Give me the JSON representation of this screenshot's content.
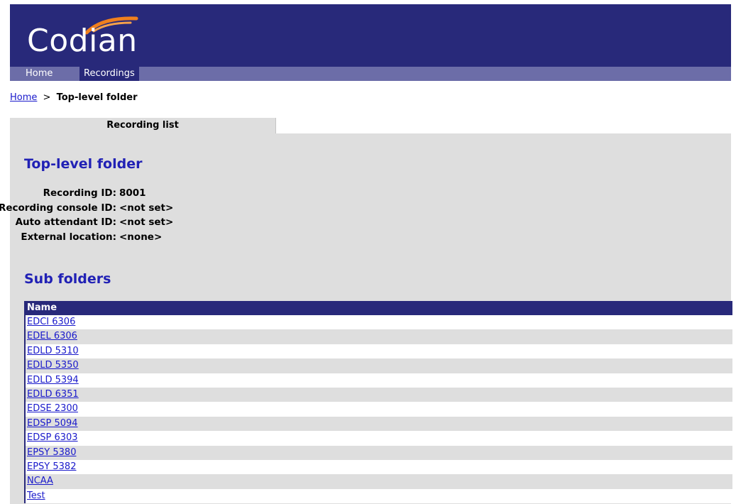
{
  "brand": {
    "logo_text": "Codian",
    "header_color": "#28297a",
    "nav_color": "#6c6da8",
    "link_color": "#1a1acb",
    "heading_color": "#2121b5"
  },
  "nav": {
    "home": "Home",
    "recordings": "Recordings"
  },
  "breadcrumb": {
    "home": "Home",
    "separator": ">",
    "current": "Top-level folder"
  },
  "tab": {
    "label": "Recording list"
  },
  "folder": {
    "title": "Top-level folder",
    "info": [
      {
        "label": "Recording ID:",
        "value": "8001"
      },
      {
        "label": "Recording console ID:",
        "value": "<not set>"
      },
      {
        "label": "Auto attendant ID:",
        "value": "<not set>"
      },
      {
        "label": "External location:",
        "value": "<none>"
      }
    ]
  },
  "subfolders": {
    "title": "Sub folders",
    "column_name": "Name",
    "items": [
      "EDCI 6306",
      "EDEL 6306",
      "EDLD 5310",
      "EDLD 5350",
      "EDLD 5394",
      "EDLD 6351",
      "EDSE 2300",
      "EDSP 5094",
      "EDSP 6303",
      "EPSY 5380",
      "EPSY 5382",
      "NCAA",
      "Test"
    ]
  }
}
